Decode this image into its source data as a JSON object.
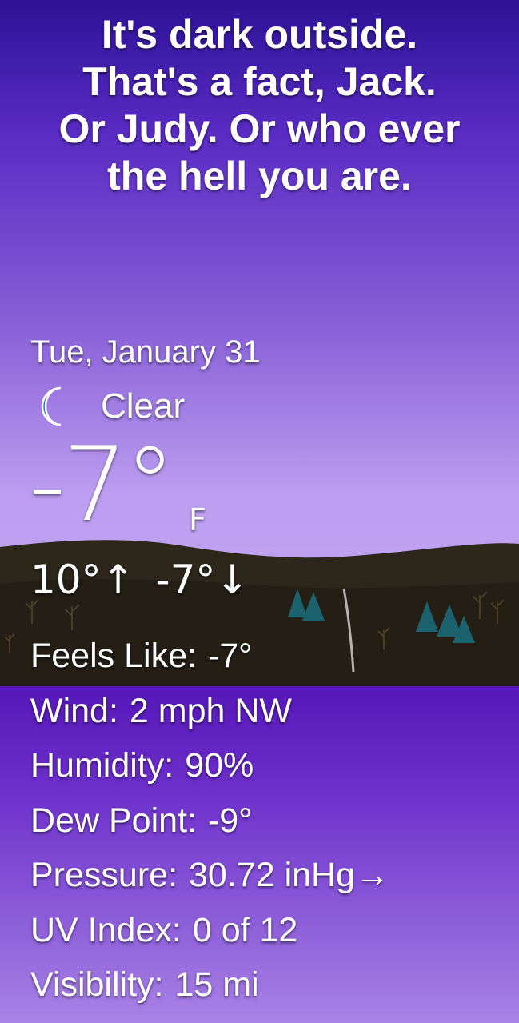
{
  "colors": {
    "sky_top": "#2c1296",
    "sky_bottom": "#c6a8f4",
    "hills": "#262017",
    "panel": "#5517b8",
    "moon": "#1e6fd8",
    "text": "#ffffff"
  },
  "headline": [
    "It's dark outside.",
    "That's a fact, Jack.",
    "Or Judy. Or who ever",
    "the hell you are."
  ],
  "date": "Tue, January 31",
  "condition": {
    "icon": "crescent-moon-icon",
    "label": "Clear"
  },
  "temperature": {
    "value": "-7°",
    "unit": "F"
  },
  "high_low": {
    "high": "10°",
    "high_arrow": "↑",
    "low": "-7°",
    "low_arrow": "↓"
  },
  "details": {
    "feels_like": {
      "label": "Feels Like:",
      "value": "-7°"
    },
    "wind": {
      "label": "Wind:",
      "value": "2 mph NW"
    },
    "humidity": {
      "label": "Humidity:",
      "value": "90%"
    },
    "dew_point": {
      "label": "Dew Point:",
      "value": "-9°"
    },
    "pressure": {
      "label": "Pressure:",
      "value": "30.72 inHg→"
    },
    "uv_index": {
      "label": "UV Index:",
      "value": "0 of 12"
    },
    "visibility": {
      "label": "Visibility:",
      "value": "15 mi"
    }
  }
}
